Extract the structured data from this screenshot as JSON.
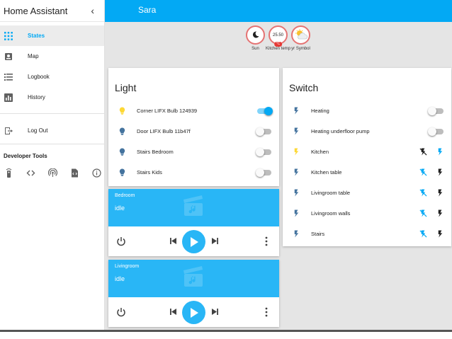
{
  "app": {
    "title": "Home Assistant",
    "collapse_glyph": "‹"
  },
  "sidebar": {
    "items": [
      {
        "label": "States",
        "icon": "grid-icon",
        "active": true
      },
      {
        "label": "Map",
        "icon": "map-icon",
        "active": false
      },
      {
        "label": "Logbook",
        "icon": "list-icon",
        "active": false
      },
      {
        "label": "History",
        "icon": "chart-icon",
        "active": false
      },
      {
        "label": "Log Out",
        "icon": "exit-icon",
        "active": false
      }
    ],
    "dev_title": "Developer Tools",
    "dev_tools": [
      "remote-icon",
      "code-icon",
      "broadcast-icon",
      "file-code-icon",
      "info-icon"
    ]
  },
  "topbar": {
    "title": "Sara"
  },
  "badges": [
    {
      "label": "Sun",
      "value": "",
      "icon": "moon-icon"
    },
    {
      "label": "Kitchen temp",
      "value": "25.50",
      "unit": "°C"
    },
    {
      "label": "yr Symbol",
      "value": "",
      "icon": "weather-icon"
    }
  ],
  "light_card": {
    "title": "Light",
    "rows": [
      {
        "name": "Corner LIFX Bulb 124939",
        "on": true
      },
      {
        "name": "Door LIFX Bulb 11b47f",
        "on": false
      },
      {
        "name": "Stairs Bedroom",
        "on": false
      },
      {
        "name": "Stairs Kids",
        "on": false
      }
    ]
  },
  "switch_card": {
    "title": "Switch",
    "rows": [
      {
        "name": "Heating",
        "control": "toggle",
        "on": false
      },
      {
        "name": "Heating underfloor pump",
        "control": "toggle",
        "on": false
      },
      {
        "name": "Kitchen",
        "control": "buttons",
        "on": true
      },
      {
        "name": "Kitchen table",
        "control": "buttons",
        "on": false
      },
      {
        "name": "Livingroom table",
        "control": "buttons",
        "on": false
      },
      {
        "name": "Livingroom walls",
        "control": "buttons",
        "on": false
      },
      {
        "name": "Stairs",
        "control": "buttons",
        "on": false
      }
    ]
  },
  "media": [
    {
      "name": "Bedroom",
      "state": "idle"
    },
    {
      "name": "Livingroom",
      "state": "idle"
    }
  ],
  "colors": {
    "accent": "#03a9f4",
    "light_on": "#fdd835",
    "icon_off": "#44739e",
    "badge_border": "#e57373"
  }
}
